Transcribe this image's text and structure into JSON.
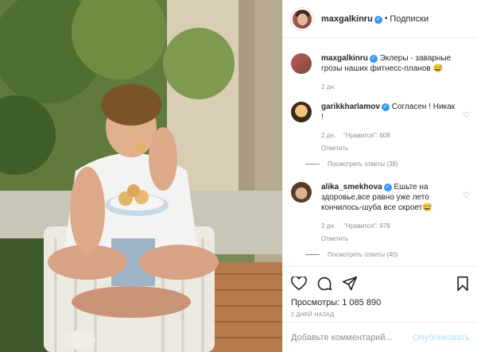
{
  "header": {
    "username": "maxgalkinru",
    "separator": "•",
    "follow_label": "Подписки"
  },
  "caption": {
    "username": "maxgalkinru",
    "text": "Эклеры - заварные грозы наших фитнесс-планов 😅",
    "time": "2 дн."
  },
  "comments": [
    {
      "username": "garikkharlamov",
      "text": "Согласен ! Никак !",
      "time": "2 дн.",
      "likes": "\"Нравится\": 608",
      "reply_label": "Ответить",
      "view_replies": "Посмотреть ответы (38)"
    },
    {
      "username": "alika_smekhova",
      "text": "Ешьте на здоровье,все равно уже лето кончилось-шуба все скроет😅",
      "time": "2 дн.",
      "likes": "\"Нравится\": 978",
      "reply_label": "Ответить",
      "view_replies": "Посмотреть ответы (40)"
    }
  ],
  "actions": {
    "like_icon": "heart-icon",
    "comment_icon": "comment-icon",
    "share_icon": "share-icon",
    "save_icon": "bookmark-icon"
  },
  "views": "Просмотры: 1 085 890",
  "post_date": "2 ДНЕЙ НАЗАД",
  "add_comment": {
    "placeholder": "Добавьте комментарий...",
    "publish_label": "Опубликовать"
  },
  "colors": {
    "verified": "#3897f0",
    "publish_disabled": "#b2dffc",
    "muted": "#8e8e8e"
  }
}
